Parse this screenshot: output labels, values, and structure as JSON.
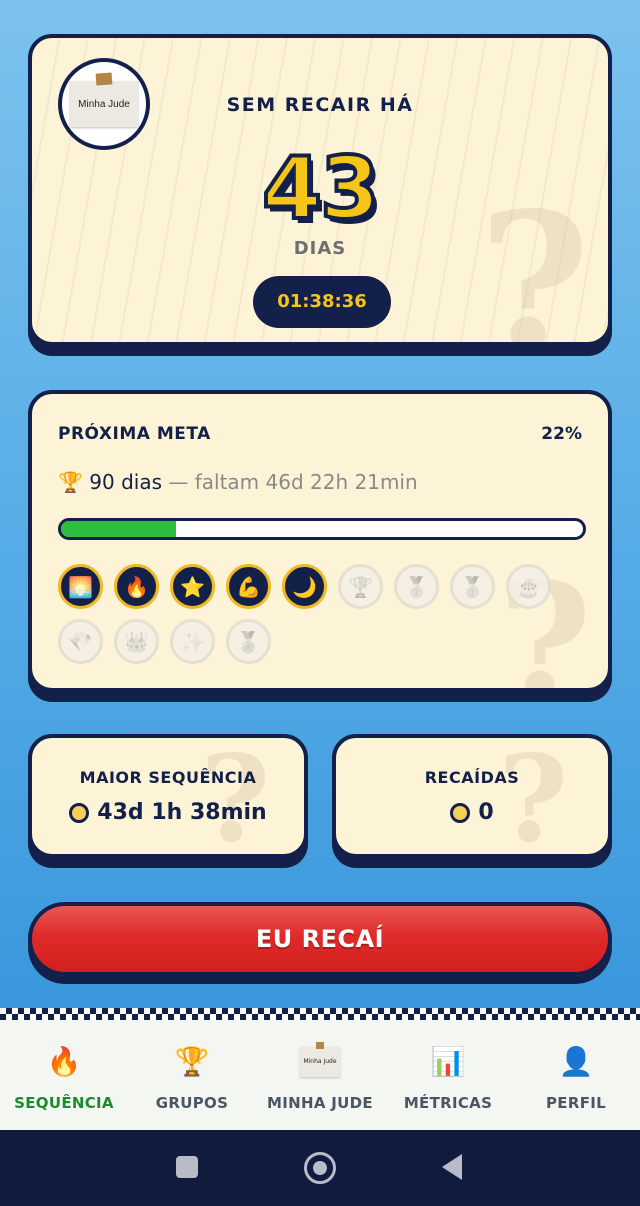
{
  "hero": {
    "avatar_alt": "Minha Jude",
    "title": "SEM RECAIR HÁ",
    "count": "43",
    "unit": "DIAS",
    "timer": "01:38:36"
  },
  "goal": {
    "label": "PRÓXIMA META",
    "percent_text": "22%",
    "progress": 0.22,
    "trophy_icon": "🏆",
    "target": "90 dias",
    "remaining": "— faltam 46d 22h 21min",
    "badges": [
      {
        "icon": "🌅",
        "name": "sunrise-badge-icon",
        "unlocked": true
      },
      {
        "icon": "🔥",
        "name": "fire-badge-icon",
        "unlocked": true
      },
      {
        "icon": "⭐",
        "name": "star-badge-icon",
        "unlocked": true
      },
      {
        "icon": "💪",
        "name": "muscle-badge-icon",
        "unlocked": true
      },
      {
        "icon": "🌙",
        "name": "moon-badge-icon",
        "unlocked": true
      },
      {
        "icon": "🏆",
        "name": "trophy-badge-icon",
        "unlocked": false
      },
      {
        "icon": "🥈",
        "name": "silver-medal-badge-icon",
        "unlocked": false
      },
      {
        "icon": "🥇",
        "name": "gold-medal-badge-icon",
        "unlocked": false
      },
      {
        "icon": "🎂",
        "name": "cake-badge-icon",
        "unlocked": false
      },
      {
        "icon": "💎",
        "name": "diamond-badge-icon",
        "unlocked": false
      },
      {
        "icon": "👑",
        "name": "crown-badge-icon",
        "unlocked": false
      },
      {
        "icon": "✨",
        "name": "sparkles-badge-icon",
        "unlocked": false
      },
      {
        "icon": "🏅",
        "name": "medal-badge-icon",
        "unlocked": false
      }
    ]
  },
  "stats": {
    "longest_label": "MAIOR SEQUÊNCIA",
    "longest_value": "43d 1h 38min",
    "relapses_label": "RECAÍDAS",
    "relapses_value": "0"
  },
  "relapse_button": "EU RECAÍ",
  "nav": {
    "items": [
      {
        "label": "SEQUÊNCIA",
        "icon": "🔥",
        "name": "fire-icon"
      },
      {
        "label": "GRUPOS",
        "icon": "🏆",
        "name": "trophy-icon"
      },
      {
        "label": "MINHA JUDE",
        "icon": "Minha Jude",
        "name": "note-icon"
      },
      {
        "label": "MÉTRICAS",
        "icon": "📊",
        "name": "chart-icon"
      },
      {
        "label": "PERFIL",
        "icon": "👤",
        "name": "person-icon"
      }
    ]
  },
  "colors": {
    "accent_yellow": "#f5c518",
    "navy": "#13204a",
    "card_bg": "#fdf3d6",
    "danger": "#de2a29",
    "success": "#2ebd3e"
  }
}
